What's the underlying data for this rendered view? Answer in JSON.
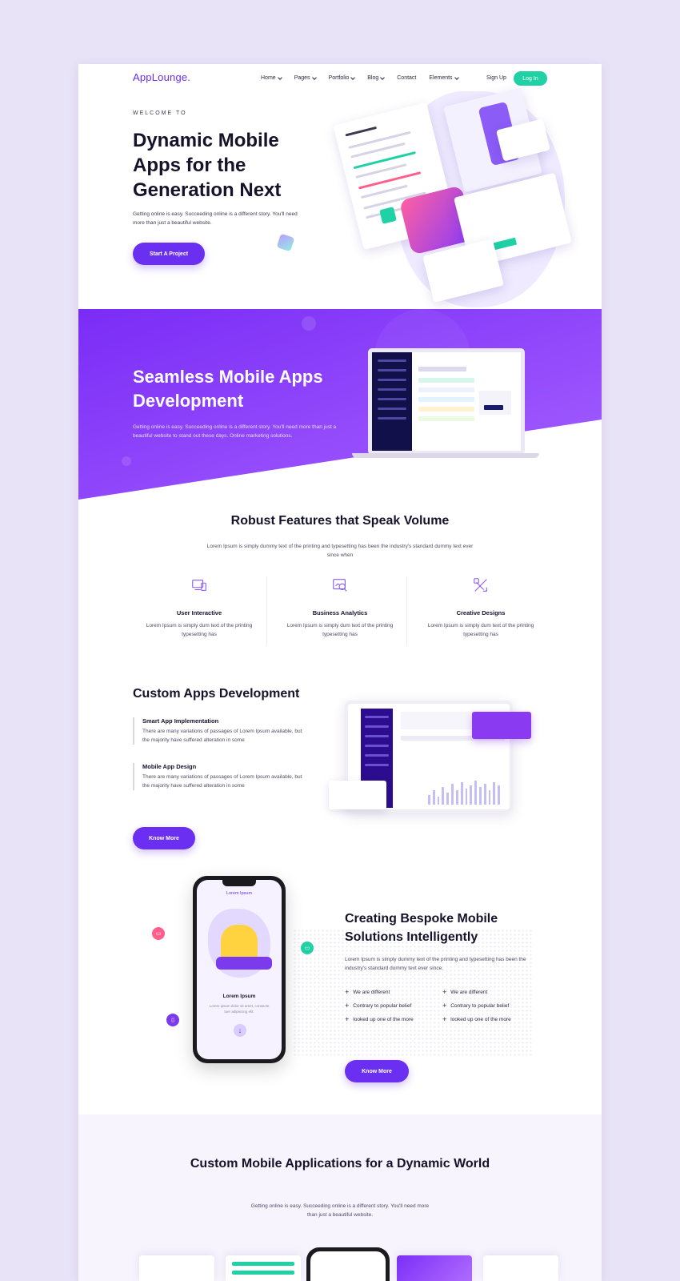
{
  "brand": {
    "logo": "AppLounge.",
    "accent": "#6a2ff0",
    "teal": "#1fd1a5"
  },
  "nav": {
    "items": [
      "Home",
      "Pages",
      "Portfolio",
      "Blog",
      "Contact",
      "Elements"
    ],
    "has_dropdown": [
      true,
      true,
      true,
      true,
      false,
      true
    ],
    "signup": "Sign Up",
    "login": "Log In"
  },
  "hero": {
    "eyebrow": "WELCOME TO",
    "title": "Dynamic Mobile Apps for the Generation Next",
    "text": "Getting online is easy. Succeeding online is a different story. You'll need more than just a beautiful website.",
    "cta": "Start A Project"
  },
  "band": {
    "title": "Seamless Mobile Apps Development",
    "text": "Getting online is easy. Succeeding online is a different story. You'll need more than just a beautiful website to stand out these days. Online marketing solutions.",
    "gradient": [
      "#7b2ff7",
      "#a259ff"
    ]
  },
  "features": {
    "title": "Robust Features that Speak Volume",
    "subtitle": "Lorem Ipsum is simply dummy text of the printing and typesetting has been the industry's standard dummy text ever since when",
    "items": [
      {
        "icon": "devices-icon",
        "title": "User Interactive",
        "text": "Lorem Ipsum is simply dum text of the printing typesetting has"
      },
      {
        "icon": "analytics-icon",
        "title": "Business Analytics",
        "text": "Lorem Ipsum is simply dum text of the printing typesetting has"
      },
      {
        "icon": "design-icon",
        "title": "Creative Designs",
        "text": "Lorem Ipsum is simply dum text of the printing typesetting has"
      }
    ]
  },
  "custom_apps": {
    "title": "Custom Apps Development",
    "items": [
      {
        "title": "Smart App Implementation",
        "text": "There are many variations of passages of Lorem Ipsum available, but the majority have suffered alteration in some"
      },
      {
        "title": "Mobile App Design",
        "text": "There are many variations of passages of Lorem Ipsum available, but the majority have suffered alteration in some"
      }
    ],
    "cta": "Know More"
  },
  "bespoke": {
    "phone_header": "Lorem Ipsum",
    "phone_title": "Lorem Ipsum",
    "phone_sub": "Lorem ipsum dolor sit amet, consecte tuer adipiscing elit.",
    "title": "Creating Bespoke Mobile Solutions Intelligently",
    "text": "Lorem Ipsum is simply dummy text of the printing and typesetting has been the industry's standard dummy text ever since.",
    "list_left": [
      "We are different",
      "Contrary to popular belief",
      "looked up one of the more"
    ],
    "list_right": [
      "We are different",
      "Contrary to popular belief",
      "looked up one of the more"
    ],
    "cta": "Know More"
  },
  "custom_mobile": {
    "title": "Custom Mobile Applications for a Dynamic World",
    "text": "Getting online is easy. Succeeding online is a different story. You'll need more than just a beautiful website."
  }
}
